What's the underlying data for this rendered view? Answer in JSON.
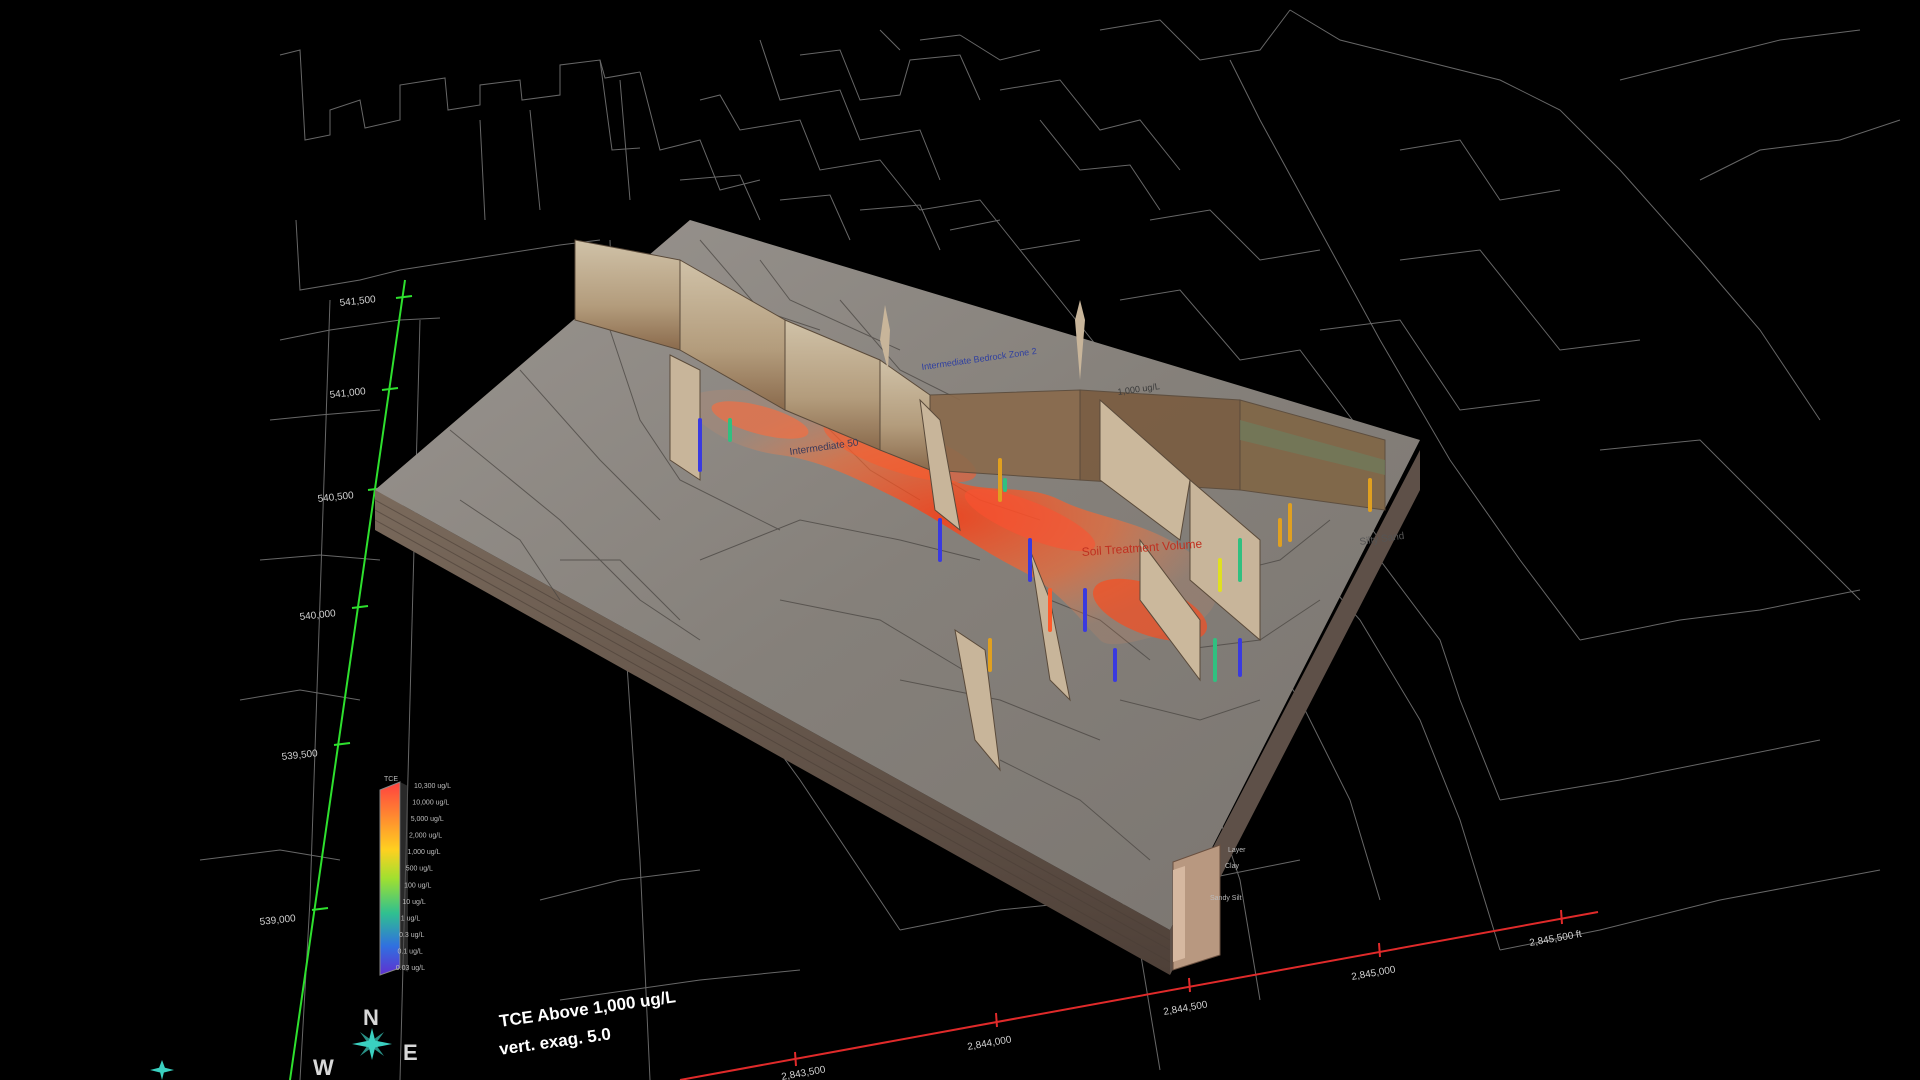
{
  "caption": {
    "title": "TCE Above 1,000 ug/L",
    "vert_exag": "vert. exag. 5.0"
  },
  "north_axis": {
    "ticks": [
      "541,500",
      "541,000",
      "540,500",
      "540,000",
      "539,500",
      "539,000"
    ]
  },
  "east_axis": {
    "ticks": [
      "2,843,500",
      "2,844,000",
      "2,844,500",
      "2,845,000",
      "2,845,500 ft"
    ]
  },
  "legend": {
    "title": "TCE",
    "labels": [
      "10,300 ug/L",
      "10,000 ug/L",
      "5,000 ug/L",
      "2,000 ug/L",
      "1,000 ug/L",
      "500 ug/L",
      "100 ug/L",
      "10 ug/L",
      "1 ug/L",
      "0.3 ug/L",
      "0.1 ug/L",
      "0.03 ug/L"
    ],
    "colors": [
      "#ff4040",
      "#ff6a3a",
      "#ff9a30",
      "#ffc020",
      "#e8e020",
      "#b8e020",
      "#70d040",
      "#30c080",
      "#20a8c0",
      "#3070e0",
      "#4040e0",
      "#6030d0"
    ]
  },
  "compass": {
    "n": "N",
    "w": "W",
    "e": "E"
  },
  "annotations": {
    "plume_label": "Soil Treatment Volume",
    "sand_label": "Silty Sand",
    "lower_left_label": "Intermediate 50",
    "upper_label": "Intermediate Bedrock Zone 2",
    "concentration_label": "1,000 ug/L",
    "strat_labels": [
      "Clay",
      "Sandy Silt"
    ],
    "strat_top": "Layer"
  },
  "colors": {
    "grid_line": "#8a8a8a",
    "north_axis": "#2ee02e",
    "east_axis": "#e02a2a",
    "block_top": "#8a8580",
    "block_side_front": "#6a5e55",
    "block_side_left": "#5a4e46",
    "plume": "#ff5a2a",
    "fence": "#c8b59a"
  }
}
